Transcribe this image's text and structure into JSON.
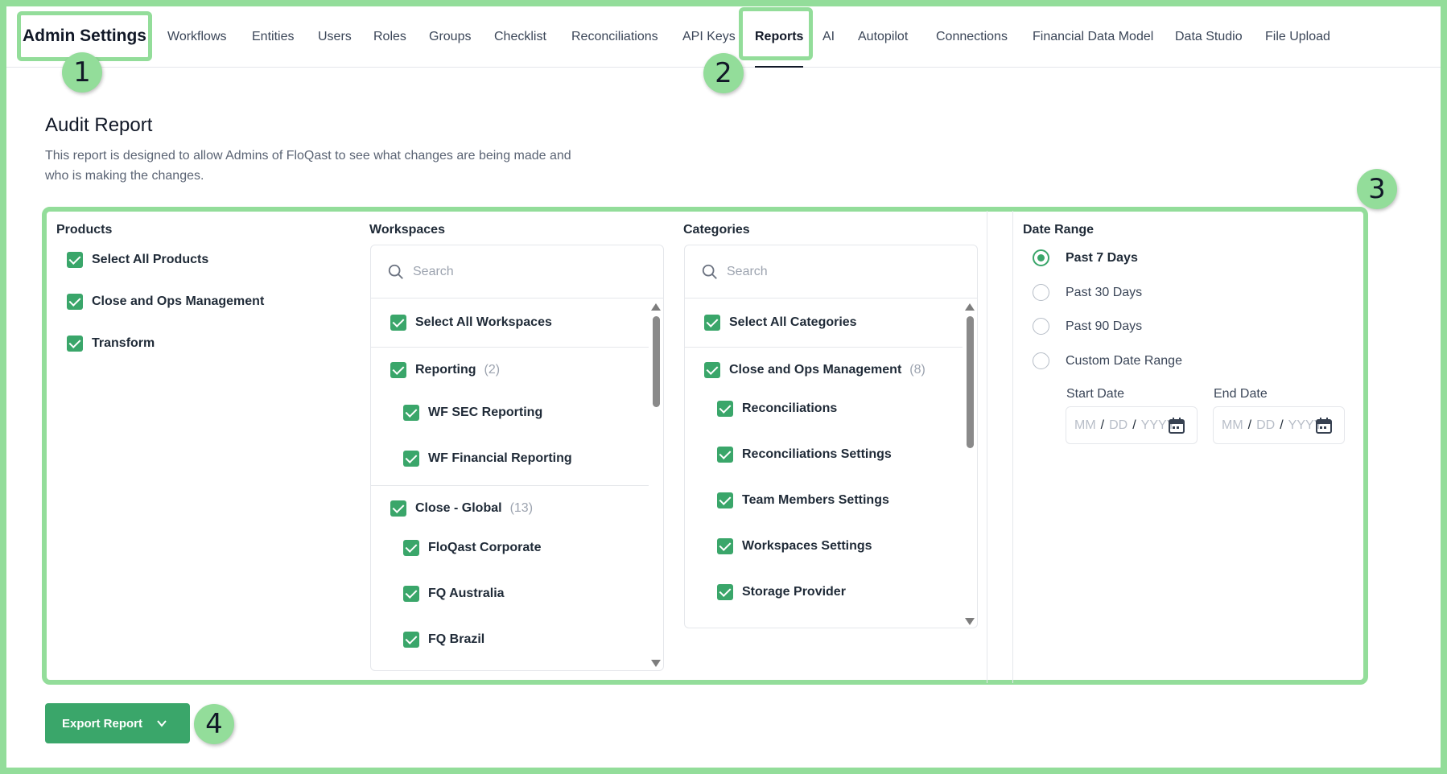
{
  "nav": {
    "brand": "Admin Settings",
    "tabs": [
      "Workflows",
      "Entities",
      "Users",
      "Roles",
      "Groups",
      "Checklist",
      "Reconciliations",
      "API Keys",
      "Reports",
      "AI",
      "Autopilot",
      "Connections",
      "Financial Data Model",
      "Data Studio",
      "File Upload"
    ],
    "active_tab": "Reports"
  },
  "markers": [
    "1",
    "2",
    "3",
    "4"
  ],
  "page": {
    "title": "Audit Report",
    "description": "This report is designed to allow Admins of FloQast to see what changes are being made and who is making the changes."
  },
  "products": {
    "title": "Products",
    "items": [
      "Select All Products",
      "Close and Ops Management",
      "Transform"
    ]
  },
  "workspaces": {
    "title": "Workspaces",
    "search_placeholder": "Search",
    "select_all": "Select All Workspaces",
    "groups": [
      {
        "name": "Reporting",
        "count": "(2)",
        "items": [
          "WF SEC Reporting",
          "WF Financial Reporting"
        ]
      },
      {
        "name": "Close - Global",
        "count": "(13)",
        "items": [
          "FloQast Corporate",
          "FQ Australia",
          "FQ Brazil"
        ]
      }
    ]
  },
  "categories": {
    "title": "Categories",
    "search_placeholder": "Search",
    "select_all": "Select All Categories",
    "groups": [
      {
        "name": "Close and Ops Management",
        "count": "(8)",
        "items": [
          "Reconciliations",
          "Reconciliations Settings",
          "Team Members Settings",
          "Workspaces Settings",
          "Storage Provider"
        ]
      }
    ]
  },
  "date_range": {
    "title": "Date Range",
    "options": [
      "Past 7 Days",
      "Past 30 Days",
      "Past 90 Days",
      "Custom Date Range"
    ],
    "selected": "Past 7 Days",
    "start_label": "Start Date",
    "end_label": "End Date",
    "date_parts": {
      "mm": "MM",
      "dd": "DD",
      "yyyy": "YYYY",
      "sep": "/"
    }
  },
  "export": {
    "label": "Export Report"
  },
  "colors": {
    "accent": "#3aa66a",
    "highlight": "#93dd9a"
  }
}
